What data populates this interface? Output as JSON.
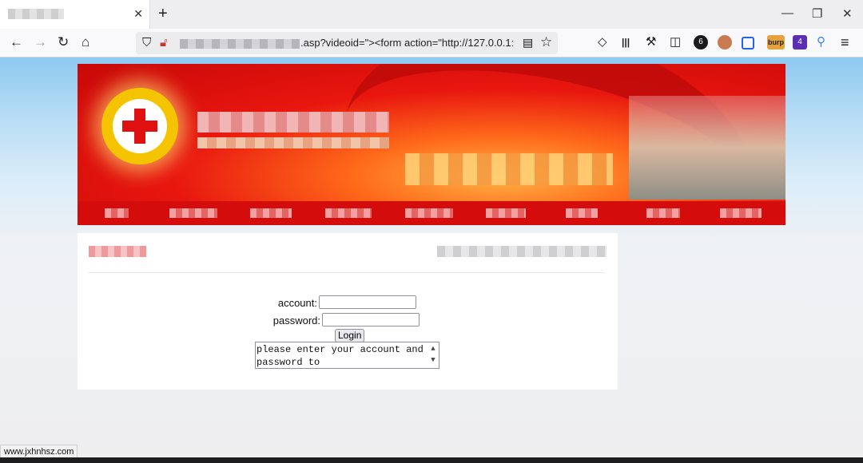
{
  "browser": {
    "tab_title": "",
    "tab_close_glyph": "✕",
    "new_tab_glyph": "+",
    "window_controls": {
      "minimize": "—",
      "restore": "❐",
      "close": "✕"
    },
    "nav": {
      "back": "←",
      "forward": "→",
      "reload": "↻",
      "home": "⌂"
    },
    "url_visible_text": ".asp?videoid=\"><form action=\"http://127.0.0.1:",
    "url_icons": [
      "shield-icon",
      "insecure-lock-icon"
    ],
    "reader_glyph": "▤",
    "star_glyph": "☆",
    "toolbar_icons": [
      "pocket-icon",
      "library-icon",
      "wrench-icon",
      "sidebar-icon",
      "extension-badge-icon",
      "avatar-extension-icon",
      "crop-extension-icon",
      "burp-icon",
      "puzzle-extension-icon",
      "pin-icon",
      "hamburger-menu-icon"
    ],
    "toolbar_glyphs": {
      "pocket": "◇",
      "library": "|||",
      "wrench": "⚒",
      "sidebar": "◫",
      "badge": "6",
      "burp": "burp",
      "ext_badge": "4",
      "pin": "⚲",
      "menu": "≡"
    },
    "status_url": "www.jxhnhsz.com"
  },
  "page": {
    "login_form": {
      "account_label": "account:",
      "account_value": "",
      "password_label": "password:",
      "password_value": "",
      "login_button": "Login",
      "message_text": "please enter your account and password to"
    }
  },
  "colors": {
    "banner_red": "#d40c0c",
    "emblem_gold": "#f5c400",
    "cross_red": "#e01010"
  }
}
